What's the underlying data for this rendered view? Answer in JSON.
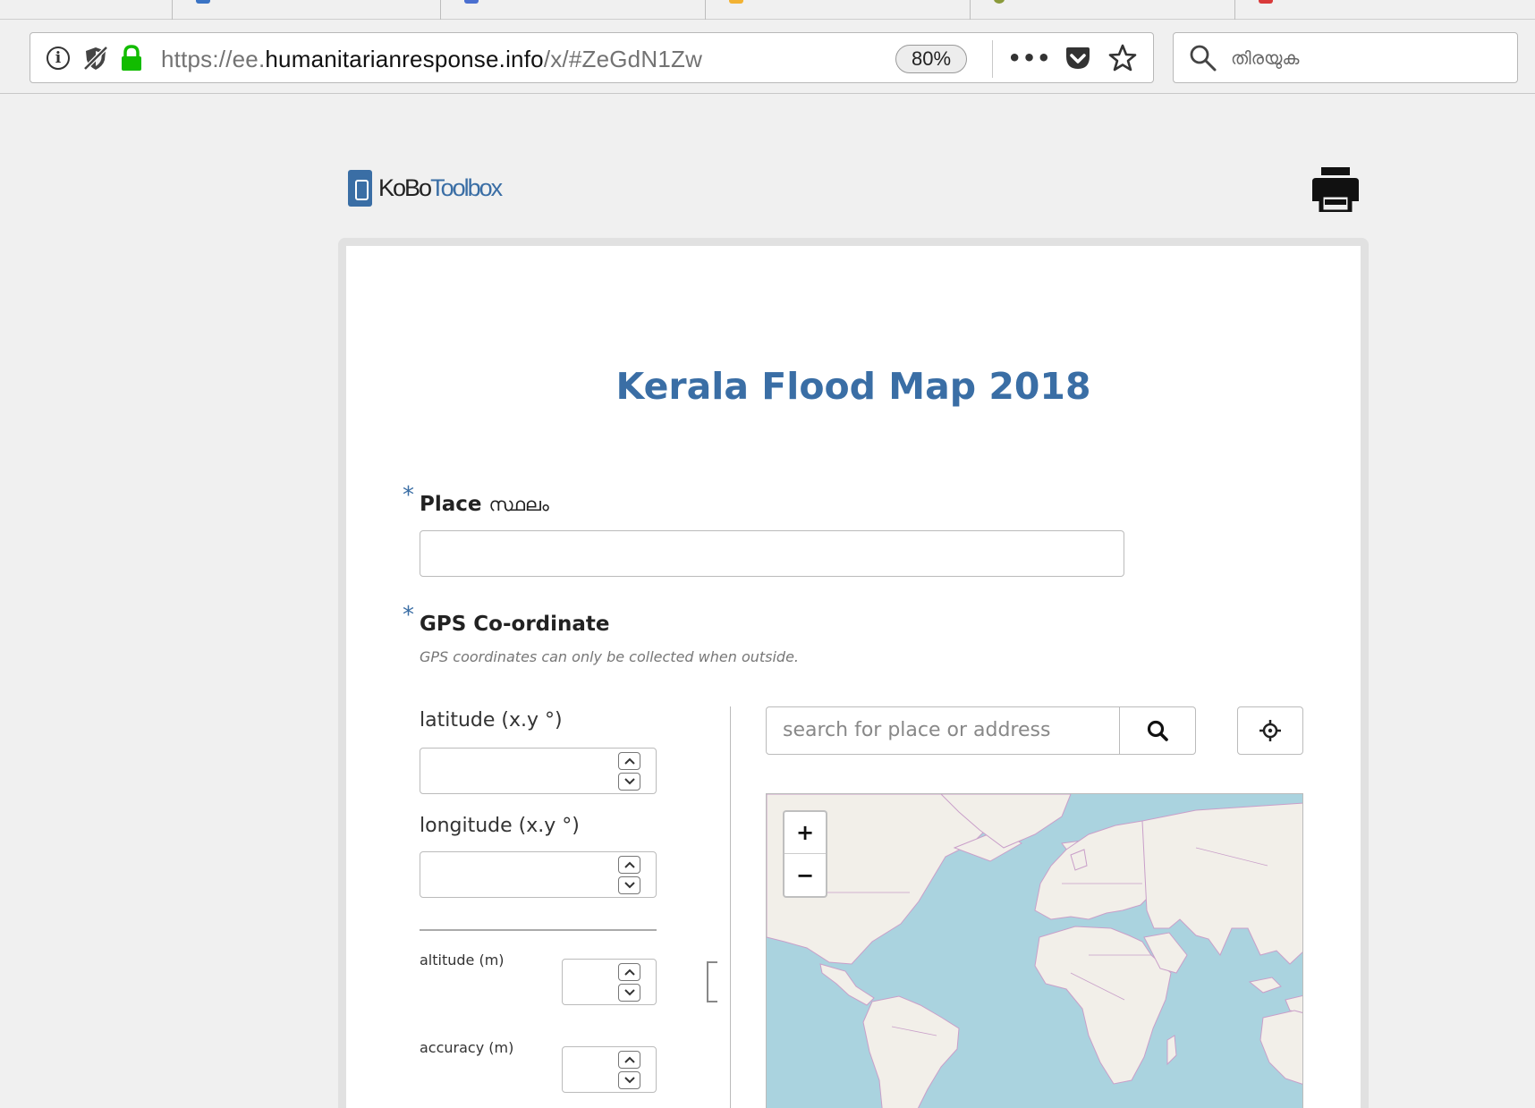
{
  "browser": {
    "url_prefix": "https://ee.",
    "url_domain": "humanitarianresponse.info",
    "url_path": "/x/#ZeGdN1Zw",
    "zoom": "80%",
    "more": "•••",
    "search_placeholder": "തിരയുക",
    "icons": [
      "info-icon",
      "tracking-protection-icon",
      "lock-icon",
      "more-icon",
      "pocket-icon",
      "star-icon",
      "search-icon"
    ]
  },
  "header": {
    "logo_part1": "KoBo",
    "logo_part2": "Toolbox",
    "print_icon": "printer-icon"
  },
  "form": {
    "title": "Kerala Flood Map 2018",
    "required_mark": "*",
    "place": {
      "label": "Place",
      "label_ml": "സ്ഥലം",
      "value": ""
    },
    "gps": {
      "label": "GPS Co-ordinate",
      "hint": "GPS coordinates can only be collected when outside.",
      "latitude_label": "latitude (x.y °)",
      "longitude_label": "longitude (x.y °)",
      "altitude_label": "altitude (m)",
      "accuracy_label": "accuracy (m)",
      "map_search_placeholder": "search for place or address",
      "zoom_in": "+",
      "zoom_out": "−"
    }
  },
  "colors": {
    "brand": "#3a6ea5",
    "map_water": "#aad3df",
    "map_land": "#f2efe9",
    "map_borders": "#c99fc9"
  }
}
